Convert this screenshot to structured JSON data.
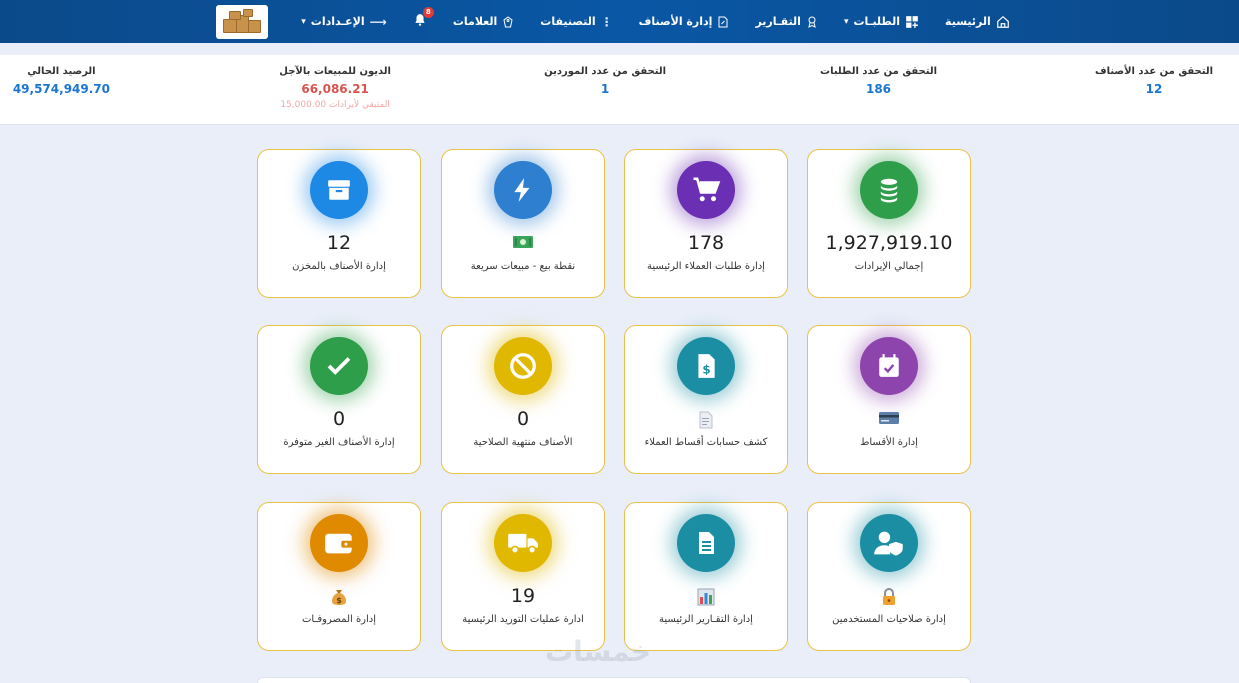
{
  "nav": {
    "home": "الرئيسية",
    "orders": "الطلبـات",
    "reports": "التقـارير",
    "items": "إدارة الأصناف",
    "categories": "التصنيفات",
    "brands": "العلامات",
    "notifications_count": "8",
    "settings": "الإعـدادات"
  },
  "stats": {
    "items_count": {
      "label": "التحقق من عدد الأصناف",
      "value": "12"
    },
    "orders_count": {
      "label": "التحقق من عدد الطلبات",
      "value": "186"
    },
    "suppliers_count": {
      "label": "التحقق من عدد الموردين",
      "value": "1"
    },
    "credit_debts": {
      "label": "الديون للمبيعات بالآجل",
      "value": "66,086.21",
      "sub": "المتبقي لأيرادات 15,000.00"
    },
    "balance": {
      "label": "الرصيد الحالي",
      "value": "49,574,949.70"
    }
  },
  "cards": {
    "revenue": {
      "value": "1,927,919.10",
      "label": "إجمالي الإيرادات"
    },
    "customer_orders": {
      "value": "178",
      "label": "إدارة طلبات العملاء الرئيسية"
    },
    "pos": {
      "label": "نقطة بيع - مبيعات سريعة"
    },
    "stock_items": {
      "value": "12",
      "label": "إدارة الأصناف بالمخزن"
    },
    "installments": {
      "label": "إدارة الأقساط"
    },
    "installment_statements": {
      "label": "كشف حسابات أقساط العملاء"
    },
    "expired_items": {
      "value": "0",
      "label": "الأصناف منتهية الصلاحية"
    },
    "unavailable_items": {
      "value": "0",
      "label": "إدارة الأصناف الغير متوفرة"
    },
    "user_permissions": {
      "label": "إدارة صلاحيات المستخدمين"
    },
    "main_reports": {
      "label": "إدارة التقـارير الرئيسية"
    },
    "supply_operations": {
      "value": "19",
      "label": "ادارة عمليات التوريد الرئيسية"
    },
    "expenses": {
      "label": "إدارة المصروفـات"
    }
  },
  "watermark": "خمسات",
  "colors": {
    "nav": "#0a57a5",
    "card_border": "#e8c24a",
    "stat_blue": "#1976d2",
    "stat_red": "#d9534f"
  }
}
